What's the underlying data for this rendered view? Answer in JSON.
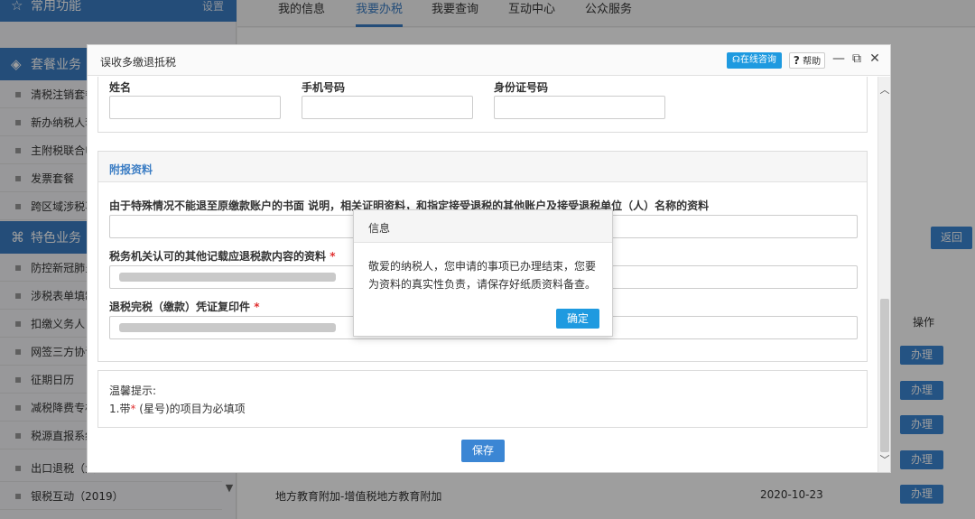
{
  "sidebar": {
    "common_title": "常用功能",
    "settings_label": "设置",
    "package_title": "套餐业务",
    "package_items": [
      "清税注销套餐",
      "新办纳税人套",
      "主附税联合申",
      "发票套餐",
      "跨区域涉税事"
    ],
    "feature_title": "特色业务",
    "feature_items": [
      "防控新冠肺炎",
      "涉税表单填制",
      "扣缴义务人（",
      "网签三方协议",
      "征期日历",
      "减税降费专栏",
      "税源直报系统",
      "出口退税（大",
      "银税互动（2019）"
    ]
  },
  "nav": {
    "tabs": [
      "我的信息",
      "我要办税",
      "我要查询",
      "互动中心",
      "公众服务"
    ],
    "active_tab": "我要办税"
  },
  "background": {
    "return_label": "返回",
    "op_header": "操作",
    "handle_label": "办理",
    "row_name": "地方教育附加-增值税地方教育附加",
    "row_date": "2020-10-23"
  },
  "dialog": {
    "title": "误收多缴退抵税",
    "consult_label": "在线咨询",
    "help_label": "帮助",
    "fields": {
      "name_label": "姓名",
      "phone_label": "手机号码",
      "id_label": "身份证号码"
    },
    "attach": {
      "section_title": "附报资料",
      "item1_label": "由于特殊情况不能退至原缴款账户的书面 说明，相关证明资料，和指定接受退税的其他账户及接受退税单位（人）名称的资料",
      "item2_label": "税务机关认可的其他记载应退税款内容的资料",
      "item3_label": "退税完税（缴款）凭证复印件",
      "required_mark": "*"
    },
    "tips": {
      "title": "温馨提示:",
      "line_prefix": "1.带",
      "line_mark": "*",
      "line_suffix": "(星号)的项目为必填项"
    },
    "save_label": "保存"
  },
  "message": {
    "title": "信息",
    "body": "敬爱的纳税人，您申请的事项已办理结束，您要为资料的真实性负责，请保存好纸质资料备查。",
    "ok_label": "确定"
  },
  "colors": {
    "accent": "#3b7dc4",
    "button": "#3b86d4",
    "consult": "#1e9ae0",
    "required": "#e03131"
  }
}
